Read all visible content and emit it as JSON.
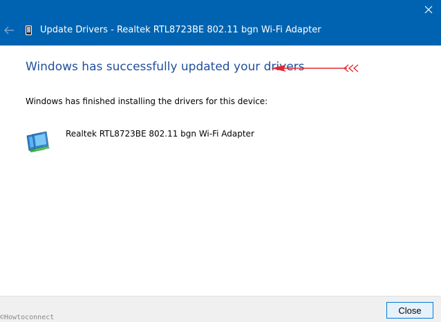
{
  "window": {
    "title": "Update Drivers - Realtek RTL8723BE 802.11 bgn Wi-Fi Adapter",
    "close_glyph": "✕",
    "back_icon": "back-arrow-icon",
    "titlebar_color": "#0063b1"
  },
  "main": {
    "heading": "Windows has successfully updated your drivers",
    "description": "Windows has finished installing the drivers for this device:",
    "device_name": "Realtek RTL8723BE 802.11 bgn Wi-Fi Adapter",
    "device_icon": "network-adapter-icon",
    "heading_color": "#1f4e9c"
  },
  "annotation": {
    "arrow_icon": "red-arrow-icon",
    "color": "#e8262b"
  },
  "footer": {
    "close_label": "Close"
  },
  "watermark": {
    "text": "©Howtoconnect"
  }
}
